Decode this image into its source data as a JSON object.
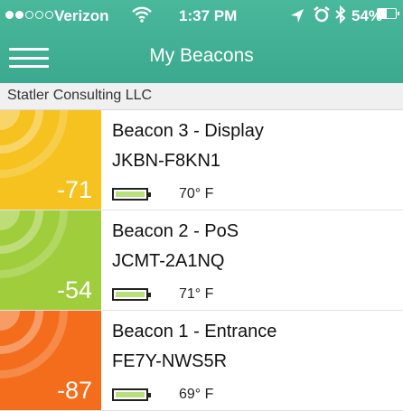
{
  "status_bar": {
    "carrier": "Verizon",
    "time": "1:37 PM",
    "battery_percent": "54%",
    "signal_bars": 2,
    "icons": [
      "wifi-icon",
      "location-icon",
      "alarm-icon",
      "bluetooth-icon",
      "battery-icon"
    ]
  },
  "nav": {
    "title": "My Beacons",
    "menu_icon": "hamburger-menu-icon"
  },
  "section": {
    "label": "Statler Consulting LLC"
  },
  "beacons": [
    {
      "rssi": "-71",
      "name": "Beacon 3 - Display",
      "id": "JKBN-F8KN1",
      "temperature": "70° F",
      "color": "#f6c21f",
      "battery_fraction": 1.0
    },
    {
      "rssi": "-54",
      "name": "Beacon 2 - PoS",
      "id": "JCMT-2A1NQ",
      "temperature": "71° F",
      "color": "#9fcd3c",
      "battery_fraction": 1.0
    },
    {
      "rssi": "-87",
      "name": "Beacon 1 - Entrance",
      "id": "FE7Y-NWS5R",
      "temperature": "69° F",
      "color": "#f46d1c",
      "battery_fraction": 1.0
    }
  ]
}
